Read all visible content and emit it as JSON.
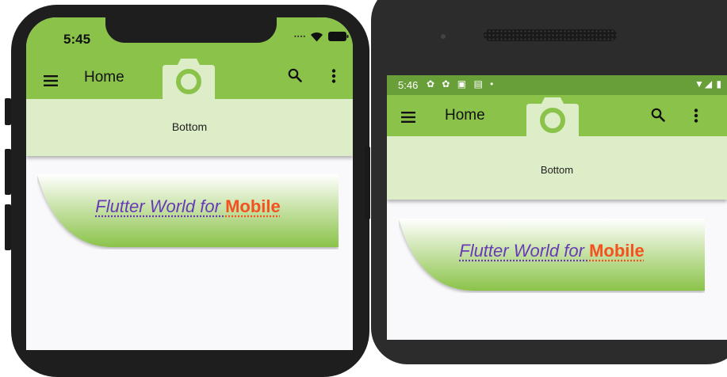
{
  "colors": {
    "primary": "#8bc34a",
    "primary_dark": "#689f38",
    "bottom_bg": "#dcedc8",
    "text_purple": "#673ab7",
    "text_orange": "#f4511e"
  },
  "ios": {
    "status": {
      "time": "5:45",
      "icons": [
        "signal-icon",
        "wifi-icon",
        "battery-icon"
      ]
    },
    "appbar": {
      "title": "Home",
      "icons": [
        "menu-icon",
        "camera-icon",
        "search-icon",
        "more-vert-icon"
      ]
    },
    "bottom_text": "Bottom",
    "card": {
      "part1": "Flutter World for ",
      "part2": "Mobile"
    }
  },
  "android": {
    "status": {
      "time": "5:46",
      "notifications": "✿ ✿ ▣ ▤ •",
      "right": "▼◢ ▮"
    },
    "appbar": {
      "title": "Home",
      "icons": [
        "menu-icon",
        "camera-icon",
        "search-icon",
        "more-vert-icon"
      ]
    },
    "bottom_text": "Bottom",
    "card": {
      "part1": "Flutter World for ",
      "part2": "Mobile"
    }
  }
}
